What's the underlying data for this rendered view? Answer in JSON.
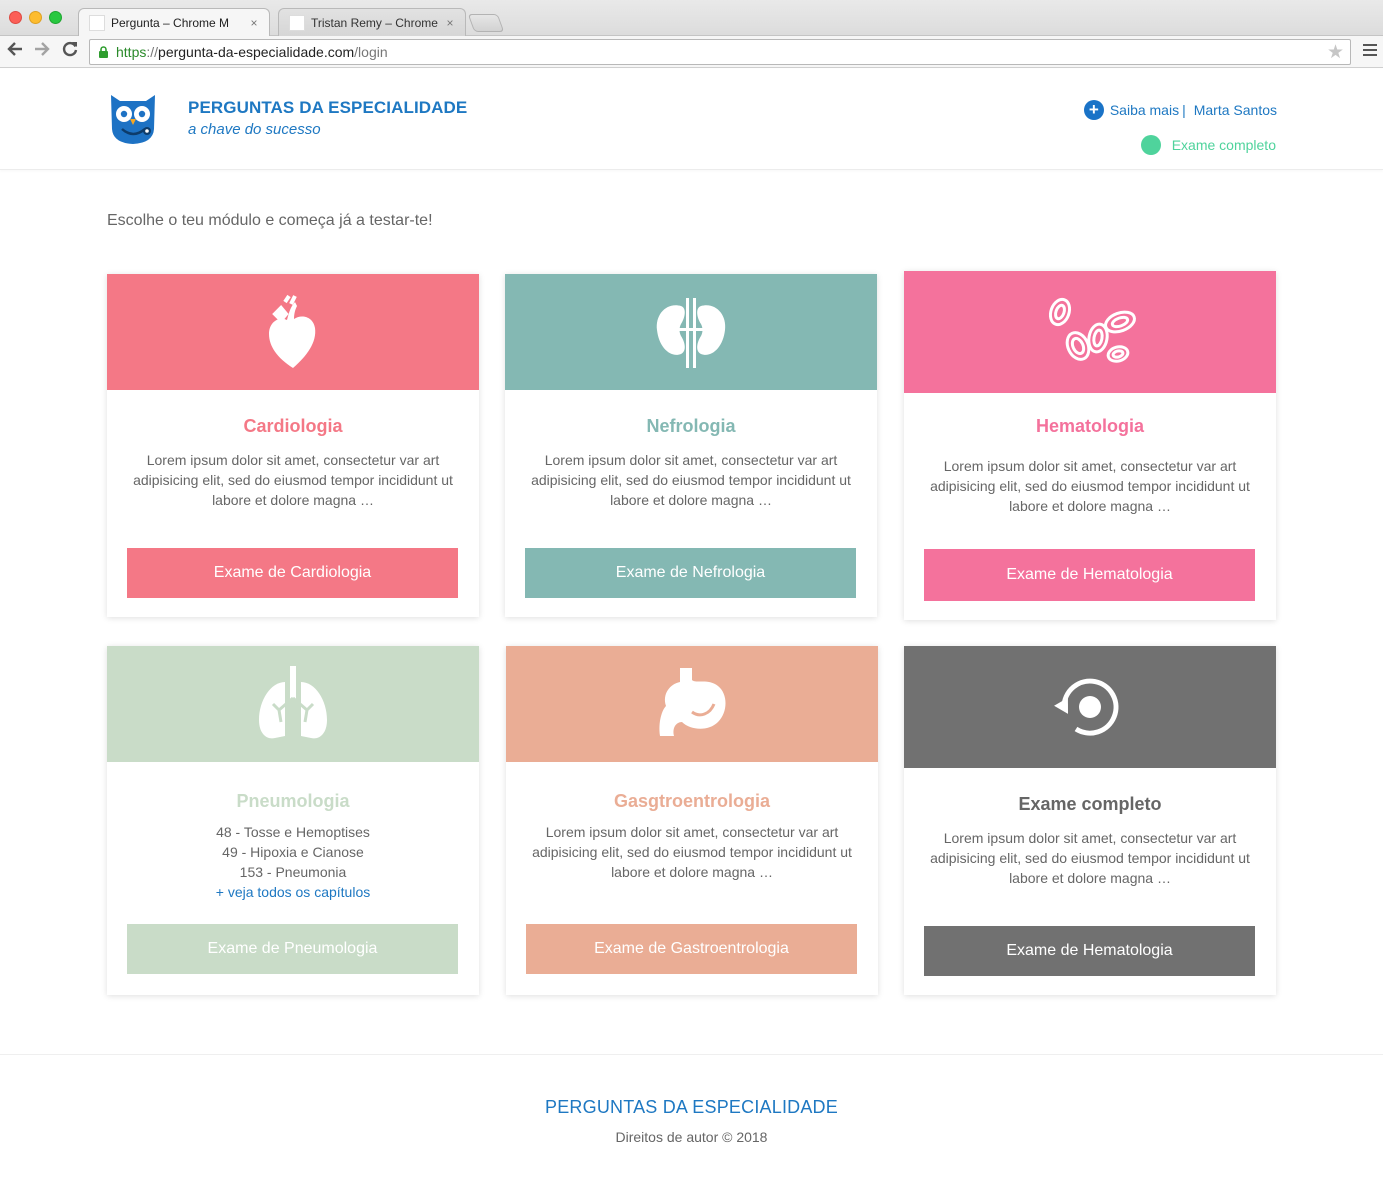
{
  "browser": {
    "tabs": [
      {
        "title": "Pergunta – Chrome M",
        "close": "×"
      },
      {
        "title": "Tristan Remy – Chrome M",
        "close": "×"
      }
    ],
    "url": {
      "scheme": "https",
      "sep": "://",
      "host": "pergunta-da-especialidade.com",
      "path": "/login"
    }
  },
  "header": {
    "brand_title": "PERGUNTAS DA ESPECIALIDADE",
    "brand_subtitle": "a chave do sucesso",
    "saiba_mais": "Saiba mais",
    "separator": "|",
    "user_name": "Marta Santos",
    "status_label": "Exame completo",
    "colors": {
      "brand": "#1e78c2",
      "status": "#4fd39c"
    }
  },
  "intro": "Escolhe o teu módulo e começa já a testar-te!",
  "cards": [
    {
      "title": "Cardiologia",
      "desc": "Lorem ipsum dolor sit amet, consectetur var art adipisicing elit, sed do eiusmod tempor incididunt ut labore et dolore magna …",
      "button": "Exame de Cardiologia",
      "color": "#f47886",
      "icon": "heart-icon"
    },
    {
      "title": "Nefrologia",
      "desc": "Lorem ipsum dolor sit amet, consectetur var art adipisicing elit, sed do eiusmod tempor incididunt ut labore et dolore magna …",
      "button": "Exame de Nefrologia",
      "color": "#84b8b3",
      "icon": "kidneys-icon"
    },
    {
      "title": "Hematologia",
      "desc": "Lorem ipsum dolor sit amet, consectetur var art adipisicing elit, sed do eiusmod tempor incididunt ut labore et dolore magna …",
      "button": "Exame de Hematologia",
      "color": "#f4729c",
      "icon": "blood-cells-icon"
    },
    {
      "title": "Pneumologia",
      "chapters": [
        "48 - Tosse e Hemoptises",
        "49 - Hipoxia e Cianose",
        "153 - Pneumonia"
      ],
      "chapters_link": "+ veja todos os capítulos",
      "button": "Exame de Pneumologia",
      "color": "#c9dcc8",
      "icon": "lungs-icon"
    },
    {
      "title": "Gasgtroentrologia",
      "desc": "Lorem ipsum dolor sit amet, consectetur var art adipisicing elit, sed do eiusmod tempor incididunt ut labore et dolore magna …",
      "button": "Exame de Gastroentrologia",
      "color": "#eaad95",
      "icon": "stomach-icon"
    },
    {
      "title": "Exame completo",
      "desc": "Lorem ipsum dolor sit amet, consectetur var art adipisicing elit, sed do eiusmod tempor incididunt ut labore et dolore magna …",
      "button": "Exame de Hematologia",
      "color": "#717171",
      "icon": "cycle-icon"
    }
  ],
  "footer": {
    "title": "PERGUNTAS DA ESPECIALIDADE",
    "copyright": "Direitos de autor © 2018"
  }
}
